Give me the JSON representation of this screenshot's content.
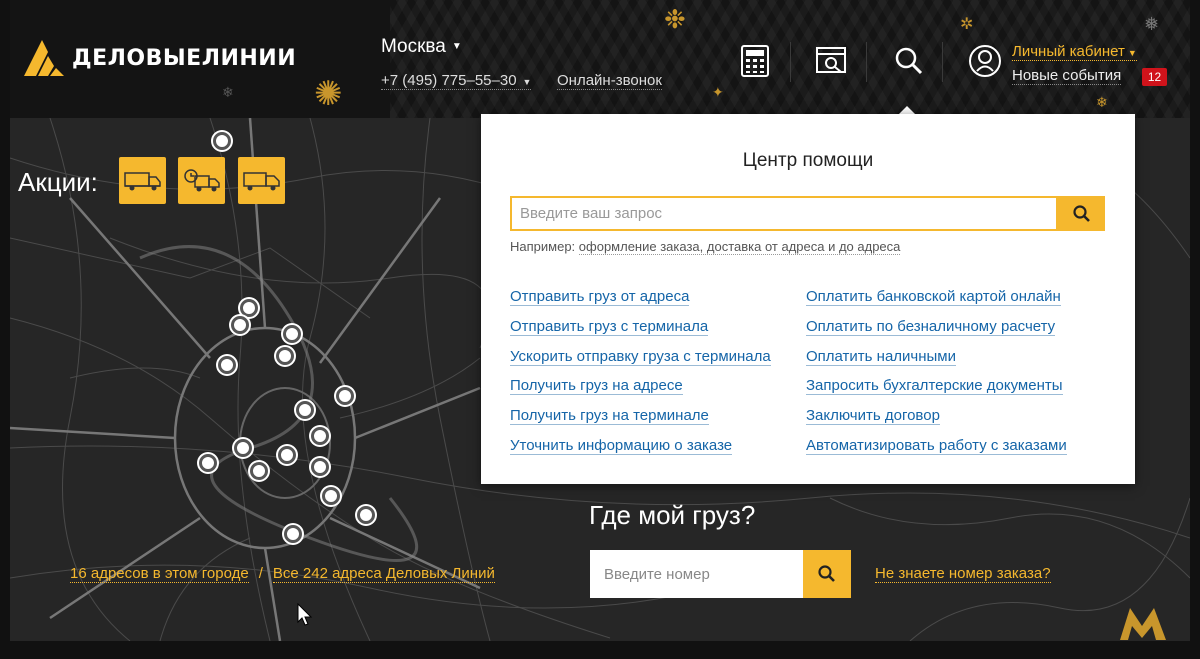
{
  "header": {
    "logo_text": "ДЕЛОВЫЕЛИНИИ",
    "city": "Москва",
    "phone": "+7 (495) 775–55–30",
    "online_call": "Онлайн-звонок",
    "icons": [
      "calculator-icon",
      "tracking-icon",
      "search-icon",
      "account-icon"
    ],
    "account_label": "Личный кабинет",
    "events_label": "Новые события",
    "events_count": "12"
  },
  "promo": {
    "title": "Акции:",
    "buttons": [
      "truck-icon",
      "timed-delivery-icon",
      "cargo-truck-icon"
    ]
  },
  "map_links": {
    "city_addresses": "16 адресов в этом городе",
    "separator": "/",
    "all_addresses": "Все 242 адреса Деловых Линий"
  },
  "help_center": {
    "title": "Центр помощи",
    "search_placeholder": "Введите ваш запрос",
    "example_label": "Например:",
    "example_text": "оформление заказа, доставка от адреса и до адреса",
    "left_links": [
      "Отправить груз от адреса",
      "Отправить груз с терминала",
      "Ускорить отправку груза с терминала",
      "Получить груз на адресе",
      "Получить груз на терминале",
      "Уточнить информацию о заказе"
    ],
    "right_links": [
      "Оплатить банковской картой онлайн",
      "Оплатить по безналичному расчету",
      "Оплатить наличными",
      "Запросить бухгалтерские документы",
      "Заключить договор",
      "Автоматизировать работу с заказами"
    ]
  },
  "tracking": {
    "title": "Где мой груз?",
    "input_placeholder": "Введите номер",
    "unknown_number": "Не знаете номер заказа?"
  },
  "colors": {
    "accent": "#f5b82e",
    "link": "#1565a8",
    "badge": "#d0131b",
    "background": "#262626"
  }
}
